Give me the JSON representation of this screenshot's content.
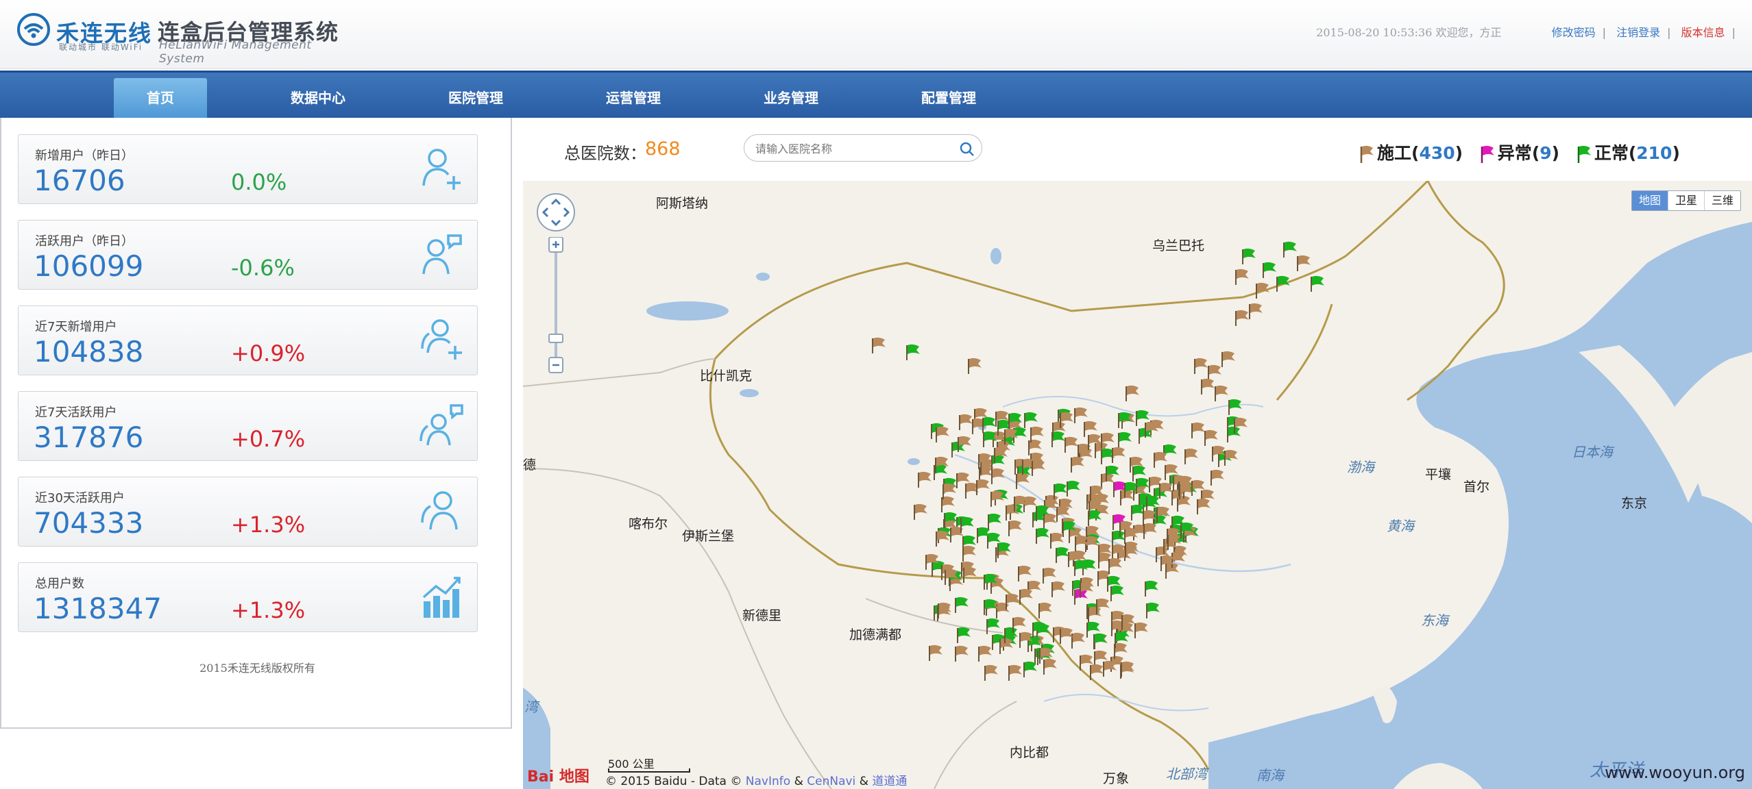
{
  "header": {
    "logo_text": "禾连无线",
    "logo_slogan": "联动城市 联动WiFi",
    "system_title": "连盒后台管理系统",
    "system_subtitle": "HeLianWiFi Management System",
    "datetime": "2015-08-20 10:53:36",
    "welcome": "欢迎您，方正",
    "links": [
      "修改密码",
      "注销登录",
      "版本信息"
    ]
  },
  "nav": {
    "items": [
      "首页",
      "数据中心",
      "医院管理",
      "运营管理",
      "业务管理",
      "配置管理"
    ],
    "active": "首页"
  },
  "stats": [
    {
      "label": "新增用户（昨日）",
      "value": "16706",
      "change": "0.0%",
      "trend": "flat",
      "icon": "add-user-icon"
    },
    {
      "label": "活跃用户（昨日）",
      "value": "106099",
      "change": "-0.6%",
      "trend": "flat",
      "icon": "chat-user-icon"
    },
    {
      "label": "近7天新增用户",
      "value": "104838",
      "change": "+0.9%",
      "trend": "up",
      "icon": "add-users-icon"
    },
    {
      "label": "近7天活跃用户",
      "value": "317876",
      "change": "+0.7%",
      "trend": "up",
      "icon": "chat-users-icon"
    },
    {
      "label": "近30天活跃用户",
      "value": "704333",
      "change": "+1.3%",
      "trend": "up",
      "icon": "users-icon"
    },
    {
      "label": "总用户数",
      "value": "1318347",
      "change": "+1.3%",
      "trend": "up",
      "icon": "growth-chart-icon"
    }
  ],
  "copyright": "2015禾连无线版权所有",
  "map_panel": {
    "total_label": "总医院数：",
    "total_value": "868",
    "search_placeholder": "请输入医院名称",
    "legend": [
      {
        "label": "施工",
        "count": "430",
        "color": "#b8895a"
      },
      {
        "label": "异常",
        "count": "9",
        "color": "#e01ab9"
      },
      {
        "label": "正常",
        "count": "210",
        "color": "#19b41f"
      }
    ],
    "map_types": [
      "地图",
      "卫星",
      "三维"
    ],
    "active_map_type": "地图",
    "cities": [
      "阿斯塔纳",
      "乌兰巴托",
      "比什凯克",
      "喀布尔",
      "伊斯兰堡",
      "新德里",
      "加德满都",
      "平壤",
      "首尔",
      "东京",
      "内比都",
      "万象",
      "德",
      "湾"
    ],
    "seas": [
      "渤海",
      "黄海",
      "东海",
      "日本海",
      "南海",
      "北部湾",
      "太平洋"
    ],
    "scale": "500 公里",
    "copyright_prefix": "© 2015 Baidu - Data ©",
    "copyright_links": [
      "NavInfo",
      "CenNavi",
      "道道通"
    ],
    "copyright_amp": "&",
    "baidu_logo": "Bai 地图",
    "watermark": "www.wooyun.org"
  }
}
